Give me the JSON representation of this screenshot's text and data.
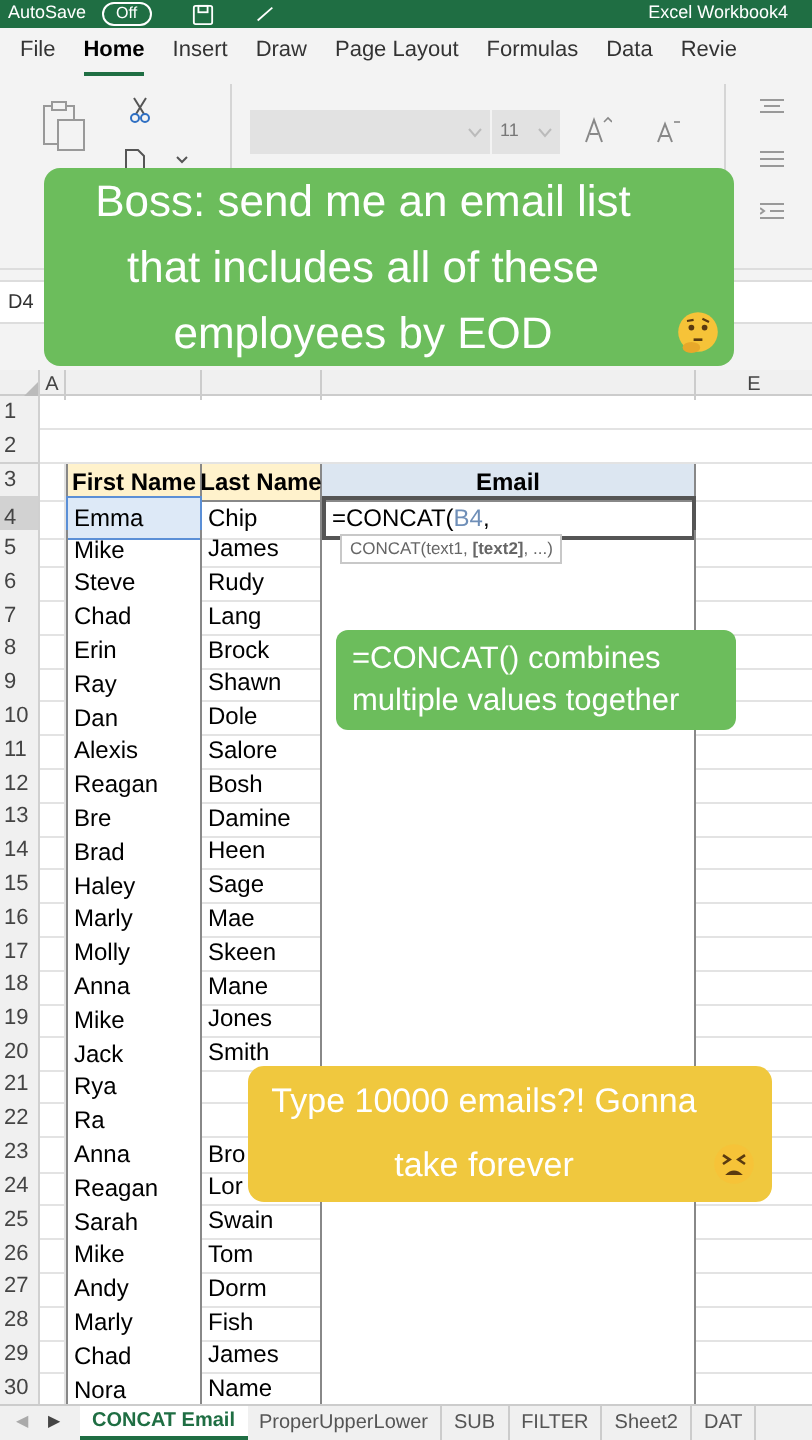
{
  "title_bar": {
    "autosave": "AutoSave",
    "toggle": "Off",
    "title": "Excel Workbook4"
  },
  "ribbon_tabs": [
    {
      "label": "File",
      "selected": false
    },
    {
      "label": "Home",
      "selected": true
    },
    {
      "label": "Insert",
      "selected": false
    },
    {
      "label": "Draw",
      "selected": false
    },
    {
      "label": "Page Layout",
      "selected": false
    },
    {
      "label": "Formulas",
      "selected": false
    },
    {
      "label": "Data",
      "selected": false
    },
    {
      "label": "Revie",
      "selected": false
    }
  ],
  "ribbon": {
    "font_size": "11"
  },
  "name_box": "D4",
  "column_header_a": "A",
  "column_header_e": "E",
  "rows": [
    {
      "number": "1",
      "kind": "blank"
    },
    {
      "number": "2",
      "kind": "blank"
    },
    {
      "number": "3",
      "kind": "header",
      "first": "First Name",
      "last": "Last Name",
      "email": "Email"
    },
    {
      "number": "4",
      "kind": "data",
      "first": "Emma",
      "last": "Chip",
      "formula": {
        "prefix": "=CONCAT(",
        "reference": "B4",
        "suffix": ","
      }
    },
    {
      "number": "5",
      "kind": "data",
      "first": "Mike",
      "last": "James"
    },
    {
      "number": "6",
      "kind": "data",
      "first": "Steve",
      "last": "Rudy"
    },
    {
      "number": "7",
      "kind": "data",
      "first": "Chad",
      "last": "Lang"
    },
    {
      "number": "8",
      "kind": "data",
      "first": "Erin",
      "last": "Brock"
    },
    {
      "number": "9",
      "kind": "data",
      "first": "Ray",
      "last": "Shawn"
    },
    {
      "number": "10",
      "kind": "data",
      "first": "Dan",
      "last": "Dole"
    },
    {
      "number": "11",
      "kind": "data",
      "first": "Alexis",
      "last": "Salore"
    },
    {
      "number": "12",
      "kind": "data",
      "first": "Reagan",
      "last": "Bosh"
    },
    {
      "number": "13",
      "kind": "data",
      "first": "Bre",
      "last": "Damine"
    },
    {
      "number": "14",
      "kind": "data",
      "first": "Brad",
      "last": "Heen"
    },
    {
      "number": "15",
      "kind": "data",
      "first": "Haley",
      "last": "Sage"
    },
    {
      "number": "16",
      "kind": "data",
      "first": "Marly",
      "last": "Mae"
    },
    {
      "number": "17",
      "kind": "data",
      "first": "Molly",
      "last": "Skeen"
    },
    {
      "number": "18",
      "kind": "data",
      "first": "Anna",
      "last": "Mane"
    },
    {
      "number": "19",
      "kind": "data",
      "first": "Mike",
      "last": "Jones"
    },
    {
      "number": "20",
      "kind": "data",
      "first": "Jack",
      "last": "Smith"
    },
    {
      "number": "21",
      "kind": "data",
      "first": "Rya"
    },
    {
      "number": "22",
      "kind": "data",
      "first": "Ra"
    },
    {
      "number": "23",
      "kind": "data",
      "first": "Anna",
      "last": "Bro"
    },
    {
      "number": "24",
      "kind": "data",
      "first": "Reagan",
      "last": "Lor"
    },
    {
      "number": "25",
      "kind": "data",
      "first": "Sarah",
      "last": "Swain"
    },
    {
      "number": "26",
      "kind": "data",
      "first": "Mike",
      "last": "Tom"
    },
    {
      "number": "27",
      "kind": "data",
      "first": "Andy",
      "last": "Dorm"
    },
    {
      "number": "28",
      "kind": "data",
      "first": "Marly",
      "last": "Fish"
    },
    {
      "number": "29",
      "kind": "data",
      "first": "Chad",
      "last": "James"
    },
    {
      "number": "30",
      "kind": "data",
      "first": "Nora",
      "last": "Name"
    }
  ],
  "tooltip": "CONCAT(text1, **[text2]**, ...)",
  "captions": [
    {
      "text": "Boss: send me an email list that includes all of these employees by EOD",
      "color": "#6cbd5c",
      "kind": "thinking"
    },
    {
      "text": "=CONCAT() combines multiple values together",
      "color": "#6cbd5c",
      "kind": "plain"
    },
    {
      "text": "Type 10000 emails?! Gonna take forever",
      "color": "#f0c83e",
      "kind": "tired"
    }
  ],
  "sheet_nav": {
    "back": "◀",
    "forward": "▶"
  },
  "sheet_tabs": [
    {
      "label": "CONCAT Email",
      "selected": true
    },
    {
      "label": "ProperUpperLower",
      "selected": false
    },
    {
      "label": "SUB",
      "selected": false
    },
    {
      "label": "FILTER",
      "selected": false
    },
    {
      "label": "Sheet2",
      "selected": false
    },
    {
      "label": "DAT",
      "selected": false
    }
  ]
}
